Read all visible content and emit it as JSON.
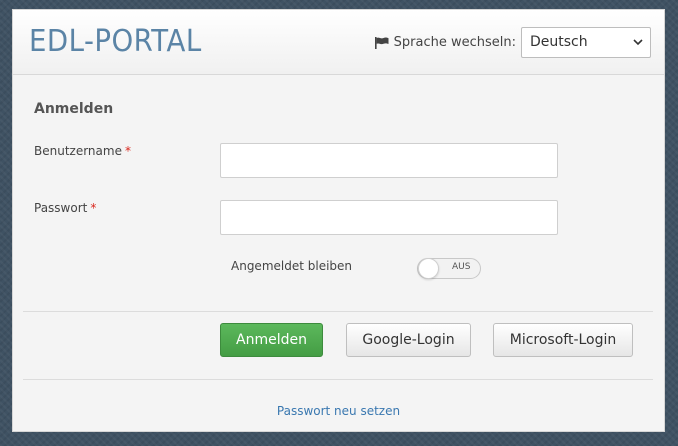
{
  "header": {
    "brand": "EDL-PORTAL",
    "language_label": "Sprache wechseln:",
    "language_selected": "Deutsch",
    "flag_icon": "flag-icon",
    "dropdown_icon": "chevron-down-icon"
  },
  "form": {
    "title": "Anmelden",
    "username_label": "Benutzername",
    "username_value": "",
    "password_label": "Passwort",
    "password_value": "",
    "required_marker": "*",
    "remember_label": "Angemeldet bleiben",
    "remember_toggle_text": "AUS",
    "remember_on": false
  },
  "actions": {
    "login": "Anmelden",
    "google": "Google-Login",
    "microsoft": "Microsoft-Login"
  },
  "footer": {
    "reset_link": "Passwort neu setzen"
  },
  "colors": {
    "brand": "#5b84a6",
    "primary_button": "#5cb85c",
    "required": "#d9261c",
    "link": "#3a78b0",
    "background": "#3f5263"
  }
}
